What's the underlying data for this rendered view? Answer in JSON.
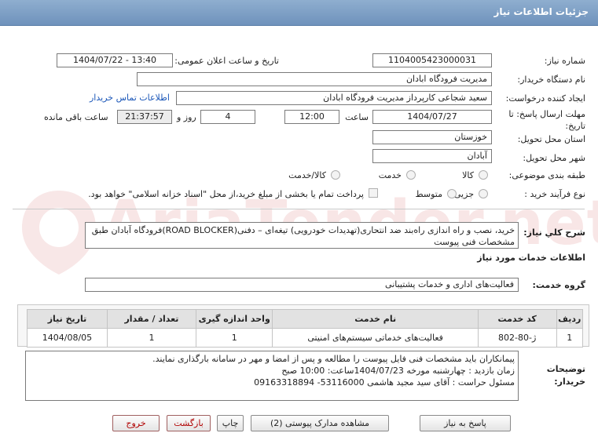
{
  "page": {
    "title": "جزئیات اطلاعات نیاز"
  },
  "fields": {
    "need_number_label": "شماره نیاز:",
    "need_number": "1104005423000031",
    "announce_label": "تاریخ و ساعت اعلان عمومی:",
    "announce_value": "1404/07/22 - 13:40",
    "buyer_org_label": "نام دستگاه خریدار:",
    "buyer_org": "مدیریت فرودگاه ابادان",
    "creator_label": "ایجاد کننده درخواست:",
    "creator": "سعید شجاعی کارپرداز مدیریت فرودگاه ابادان",
    "contact_link": "اطلاعات تماس خریدار",
    "deadline_label": "مهلت ارسال پاسخ: تا تاریخ:",
    "deadline_date": "1404/07/27",
    "time_label": "ساعت",
    "deadline_time": "12:00",
    "days_value": "4",
    "days_label": "روز و",
    "remaining_time": "21:37:57",
    "remaining_label": "ساعت باقی مانده",
    "province_label": "استان محل تحویل:",
    "province": "خوزستان",
    "city_label": "شهر محل تحویل:",
    "city": "آبادان",
    "category_label": "طبقه بندی موضوعی:",
    "category_options": [
      "کالا",
      "خدمت",
      "کالا/خدمت"
    ],
    "process_label": "نوع فرآیند خرید :",
    "process_options": [
      "جزیی",
      "متوسط"
    ],
    "payment_note": "پرداخت تمام یا بخشی از مبلغ خرید،از محل \"اسناد خزانه اسلامی\" خواهد بود."
  },
  "summary": {
    "label": "شرح کلي نياز:",
    "text": "خرید، نصب و راه اندازی راه‌بند ضد انتحاری(تهدیدات خودرویی) تیغه‌ای – دفنی(ROAD BLOCKER)فرودگاه آبادان طبق مشخصات فنی پیوست"
  },
  "services": {
    "section_title": "اطلاعات خدمات مورد نیاز",
    "group_label": "گروه خدمت:",
    "group_value": "فعالیت‌های اداری و خدمات پشتیبانی",
    "columns": [
      "ردیف",
      "کد خدمت",
      "نام خدمت",
      "واحد اندازه گیری",
      "تعداد / مقدار",
      "تاریخ نیاز"
    ],
    "rows": [
      {
        "index": "1",
        "code": "ژ-80-802",
        "name": "فعالیت‌های خدماتی سیستم‌های امنیتی",
        "unit": "1",
        "qty": "1",
        "date": "1404/08/05"
      }
    ]
  },
  "notes": {
    "label": "توضیحات خریدار:",
    "lines": [
      "پیمانکاران باید مشخصات فنی فایل  پیوست را مطالعه و پس از امضا و مهر در سامانه بارگذاری نمایند.",
      "زمان بازدید : چهارشنبه مورخه 1404/07/23ساعت: 10:00 صبح",
      "مسئول حراست : آقای سید مجید هاشمی 53116000- 09163318894"
    ]
  },
  "buttons": {
    "reply": "پاسخ به نیاز",
    "docs": "مشاهده مدارک پیوستی (2)",
    "print": "چاپ",
    "back": "بازگشت",
    "exit": "خروج"
  },
  "colors": {
    "header": "#7a9cc6",
    "link": "#1a56b8",
    "danger": "#b00000"
  }
}
